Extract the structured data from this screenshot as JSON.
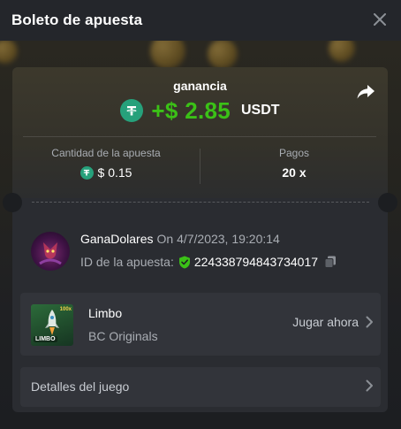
{
  "header": {
    "title": "Boleto de apuesta"
  },
  "profit": {
    "label": "ganancia",
    "value": "+$ 2.85",
    "currency": "USDT"
  },
  "stats": {
    "amount_label": "Cantidad de la apuesta",
    "amount_value": "$ 0.15",
    "payout_label": "Pagos",
    "payout_value": "20 x"
  },
  "bet": {
    "username": "GanaDolares",
    "date": "On 4/7/2023, 19:20:14",
    "id_label": "ID de la apuesta:",
    "id_value": "224338794843734017"
  },
  "game": {
    "title": "Limbo",
    "provider": "BC Originals",
    "play_label": "Jugar ahora",
    "thumb_label": "LIMBO",
    "thumb_badge": "100x"
  },
  "details": {
    "label": "Detalles del juego"
  },
  "colors": {
    "profit_green": "#3bc117",
    "tether_green": "#26a17b",
    "card_bg": "#2a2c31",
    "row_bg": "#32343a"
  },
  "icons": [
    "close-icon",
    "tether-icon",
    "share-icon",
    "shield-check-icon",
    "copy-icon",
    "chevron-right-icon",
    "avatar"
  ]
}
